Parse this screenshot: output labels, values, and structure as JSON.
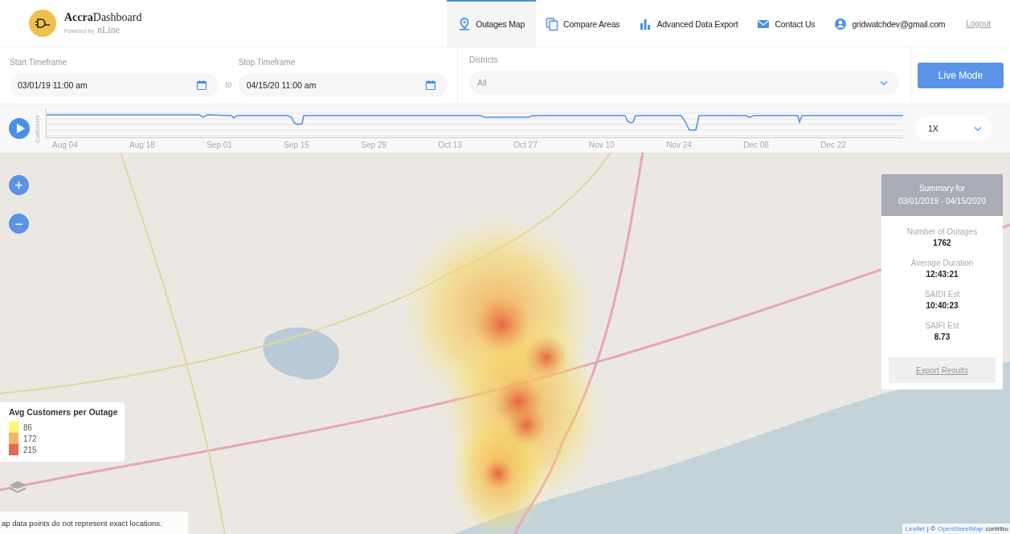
{
  "header": {
    "logo": {
      "name_a": "Accra",
      "name_b": "Dashboard",
      "powered_by": "Powered by",
      "brand": "nLine"
    },
    "nav": [
      {
        "label": "Outages Map",
        "kind": "map",
        "selected": true
      },
      {
        "label": "Compare Areas",
        "kind": "compare",
        "selected": false
      },
      {
        "label": "Advanced Data Export",
        "kind": "export",
        "selected": false
      },
      {
        "label": "Contact Us",
        "kind": "contact",
        "selected": false
      },
      {
        "label": "gridwatchdev@gmail.com",
        "kind": "account",
        "selected": false
      }
    ],
    "logout": "Logout"
  },
  "filters": {
    "start": {
      "label": "Start Timeframe",
      "value": "03/01/19 11:00 am"
    },
    "separator": "to",
    "stop": {
      "label": "Stop Timeframe",
      "value": "04/15/20 11:00 am"
    },
    "districts": {
      "label": "Districts",
      "value": "All"
    },
    "live_mode": "Live Mode"
  },
  "timeline": {
    "ylabel": "Customers",
    "xticks": [
      "Aug 04",
      "Aug 18",
      "Sep 01",
      "Sep 15",
      "Sep 29",
      "Oct 13",
      "Oct 27",
      "Nov 10",
      "Nov 24",
      "Dec 08",
      "Dec 22"
    ],
    "speed": "1X"
  },
  "map": {
    "zoom_in": "+",
    "zoom_out": "−",
    "summary": {
      "title": "Summary for",
      "range": "03/01/2019 - 04/15/2020",
      "stats": [
        {
          "label": "Number of Outages",
          "value": "1762"
        },
        {
          "label": "Average Duration",
          "value": "12:43:21"
        },
        {
          "label": "SAIDI Est",
          "value": "10:40:23"
        },
        {
          "label": "SAIFI Est",
          "value": "8.73"
        }
      ],
      "export": "Export Results"
    },
    "legend": {
      "title": "Avg Customers per Outage",
      "items": [
        {
          "label": "86",
          "color": "#fdf57a"
        },
        {
          "label": "172",
          "color": "#f2b46a"
        },
        {
          "label": "215",
          "color": "#e4695a"
        }
      ]
    },
    "disclaimer": "ap data points do not represent exact locations.",
    "attribution": {
      "leaflet": "Leaflet",
      "sep": "| ©",
      "osm": "OpenStreetMap",
      "rest": "contribu"
    }
  }
}
